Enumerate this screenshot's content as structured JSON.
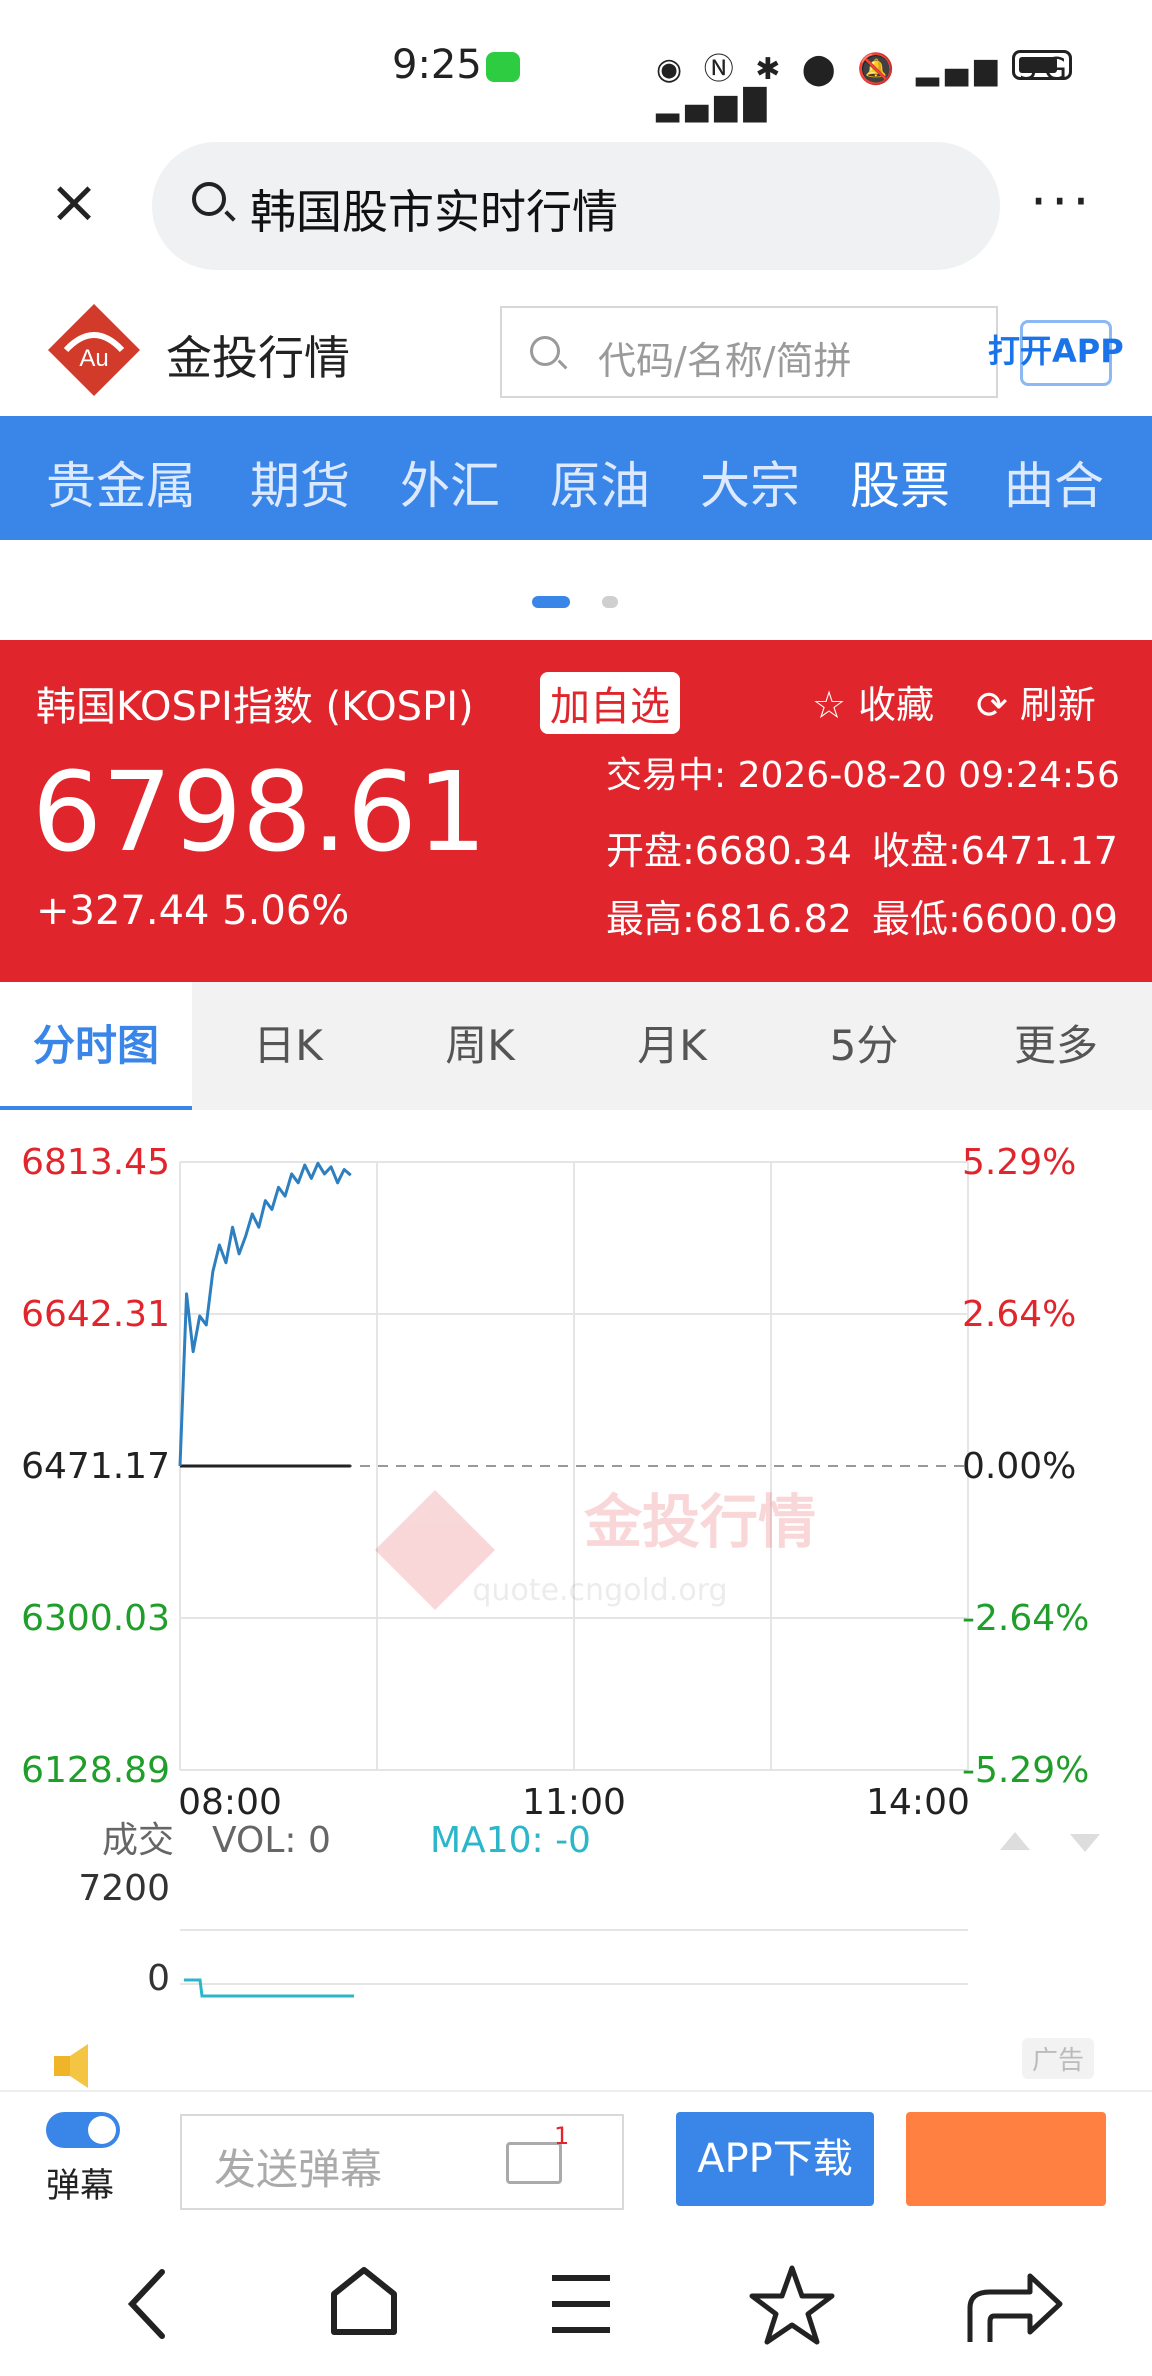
{
  "status_bar": {
    "time": "9:25",
    "network": "5G"
  },
  "top_search": {
    "query": "韩国股市实时行情"
  },
  "brand": {
    "name": "金投行情",
    "logo_text": "Au",
    "search_placeholder": "代码/名称/简拼",
    "open_app": "打开APP"
  },
  "nav": {
    "items": [
      "贵金属",
      "期货",
      "外汇",
      "原油",
      "大宗",
      "股票",
      "曲合"
    ],
    "active_index": 5
  },
  "quote": {
    "name": "韩国KOSPI指数 (KOSPI)",
    "add_watch": "加自选",
    "favorite": "收藏",
    "refresh": "刷新",
    "price": "6798.61",
    "change": "+327.44",
    "change_pct": "5.06%",
    "status": "交易中:",
    "datetime": "2026-08-20 09:24:56",
    "open": "开盘:6680.34",
    "close": "收盘:6471.17",
    "high": "最高:6816.82",
    "low": "最低:6600.09"
  },
  "tabs": [
    "分时图",
    "日K",
    "周K",
    "月K",
    "5分",
    "更多"
  ],
  "chart_data": {
    "type": "line",
    "y_left_labels": [
      "6813.45",
      "6642.31",
      "6471.17",
      "6300.03",
      "6128.89"
    ],
    "y_right_labels": [
      "5.29%",
      "2.64%",
      "0.00%",
      "-2.64%",
      "-5.29%"
    ],
    "x_labels": [
      "08:00",
      "11:00",
      "14:00"
    ],
    "ylim": [
      6128.89,
      6813.45
    ],
    "baseline": 6471.17,
    "watermark_text": "金投行情",
    "watermark_url": "quote.cngold.org",
    "x": [
      0,
      2,
      4,
      6,
      8,
      10,
      12,
      14,
      16,
      18,
      20,
      22,
      24,
      26,
      28,
      30,
      32,
      34,
      36,
      38,
      40,
      42,
      44,
      46,
      48,
      50,
      52
    ],
    "values": [
      6471.17,
      6665,
      6600,
      6640,
      6630,
      6690,
      6720,
      6700,
      6740,
      6710,
      6730,
      6755,
      6740,
      6770,
      6760,
      6785,
      6775,
      6800,
      6790,
      6810,
      6795,
      6812,
      6800,
      6808,
      6790,
      6805,
      6798.61
    ],
    "color_up": "#e0262c",
    "color_down": "#1f9e2a",
    "line_color": "#2d7fbf"
  },
  "volume": {
    "label": "成交",
    "vol": "VOL: 0",
    "ma10": "MA10: -0",
    "y_labels": [
      "7200",
      "0"
    ]
  },
  "ad_tag": "广告",
  "bottom_bar": {
    "danmu_label": "弹幕",
    "danmu_placeholder": "发送弹幕",
    "mail_badge": "1",
    "app_download": "APP下载"
  }
}
